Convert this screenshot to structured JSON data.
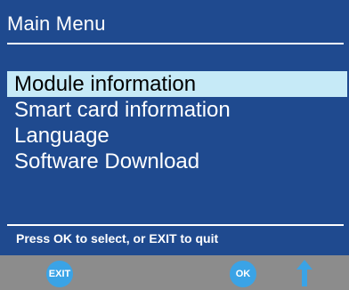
{
  "screen": {
    "title": "Main Menu",
    "selected_index": 0,
    "menu": [
      {
        "label": "Module information"
      },
      {
        "label": "Smart card information"
      },
      {
        "label": "Language"
      },
      {
        "label": "Software Download"
      }
    ],
    "hint": "Press OK to select, or EXIT to quit"
  },
  "footer": {
    "exit_label": "EXIT",
    "ok_label": "OK",
    "nav_icon": "up-arrow-icon"
  },
  "colors": {
    "background": "#1f4a8f",
    "selection": "#c6eaf7",
    "footer": "#8c8c8c",
    "button": "#3aa3e6"
  }
}
